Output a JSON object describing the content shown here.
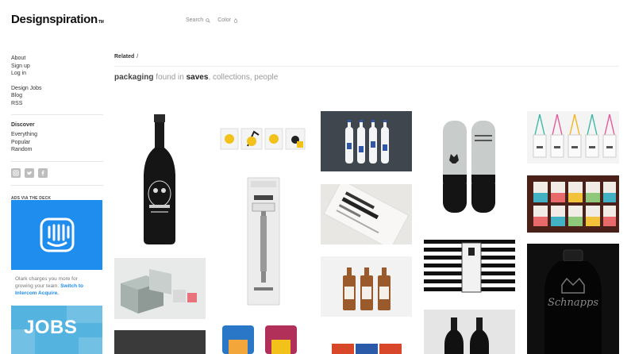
{
  "brand": {
    "name": "Designspiration",
    "tm": "TM"
  },
  "topnav": {
    "search_label": "Search",
    "color_label": "Color"
  },
  "sidebar": {
    "account": [
      "About",
      "Sign up",
      "Log in"
    ],
    "site": [
      "Design Jobs",
      "Blog",
      "RSS"
    ],
    "discover_heading": "Discover",
    "discover": [
      "Everything",
      "Popular",
      "Random"
    ],
    "social_icons": [
      "instagram-icon",
      "twitter-icon",
      "facebook-icon"
    ],
    "ads_label": "ADS VIA THE DECK"
  },
  "ad": {
    "text_before": "Olark charges you more for growing your team. ",
    "link_text": "Switch to Intercom Acquire.",
    "jobs_label": "JOBS",
    "brand_color": "#1f8ded"
  },
  "main": {
    "breadcrumb": "Related",
    "breadcrumb_sep": "/",
    "query": {
      "term": "packaging",
      "found_in": "found in",
      "saves": "saves",
      "collections": "collections",
      "people": "people"
    }
  },
  "tiles": [
    {
      "name": "wine-bottle-skull-label",
      "bg": "#ffffff"
    },
    {
      "name": "box-packaging-gray",
      "bg": "#dfe3e2"
    },
    {
      "name": "dark-box-packaging",
      "bg": "#3a3a3a"
    },
    {
      "name": "lamp-boxes-yellow",
      "bg": "#ffffff"
    },
    {
      "name": "gillette-razor-package",
      "bg": "#ffffff"
    },
    {
      "name": "snack-bags-colorful",
      "bg": "#ffffff"
    },
    {
      "name": "blue-white-bottles",
      "bg": "#3f444b"
    },
    {
      "name": "new-york-labels",
      "bg": "#e9e7e3"
    },
    {
      "name": "amber-bottles",
      "bg": "#f2f2f2"
    },
    {
      "name": "colored-tape-rolls",
      "bg": "#ffffff"
    },
    {
      "name": "black-elk-bottles",
      "bg": "#ffffff"
    },
    {
      "name": "black-white-stripes-box",
      "bg": "#ffffff"
    },
    {
      "name": "dark-wine-bottles",
      "bg": "#e5e5e5"
    },
    {
      "name": "hanging-tags-colorful",
      "bg": "#f4f4f4"
    },
    {
      "name": "colorful-cans",
      "bg": "#4a2118"
    },
    {
      "name": "black-bottle-crown",
      "bg": "#0f0f0f"
    }
  ]
}
